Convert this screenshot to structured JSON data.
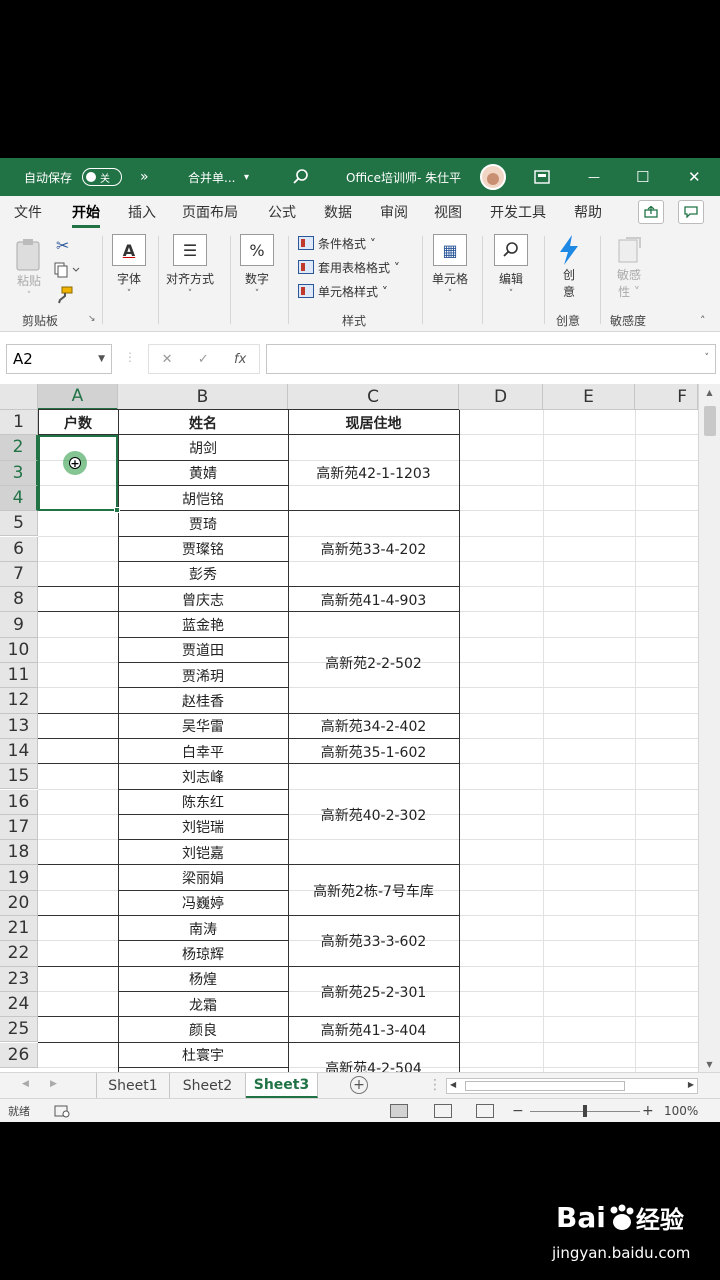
{
  "titlebar": {
    "autosave_label": "自动保存",
    "autosave_state": "关",
    "more": "»",
    "merge_label": "合并单...",
    "merge_arrow": "▾",
    "doc_title": "Office培训师- 朱仕平",
    "minimize": "—",
    "maximize": "☐",
    "close": "✕"
  },
  "tabs": [
    "文件",
    "开始",
    "插入",
    "页面布局",
    "公式",
    "数据",
    "审阅",
    "视图",
    "开发工具",
    "帮助"
  ],
  "ribbon": {
    "paste": "粘贴",
    "clipboard_group": "剪贴板",
    "font": "字体",
    "alignment": "对齐方式",
    "number": "数字",
    "conditional_format": "条件格式 ˅",
    "table_format": "套用表格格式 ˅",
    "cell_style": "单元格样式 ˅",
    "styles_group": "样式",
    "cells": "单元格",
    "editing": "编辑",
    "create_a": "创",
    "create_b": "意",
    "create_group": "创意",
    "sens_a": "敏感",
    "sens_b": "性 ˅",
    "sens_group": "敏感度"
  },
  "formula_bar": {
    "name_box": "A2",
    "cancel": "✕",
    "confirm": "✓",
    "fx": "fx",
    "value": ""
  },
  "columns": [
    "A",
    "B",
    "C",
    "D",
    "E",
    "F"
  ],
  "rows": [
    "1",
    "2",
    "3",
    "4",
    "5",
    "6",
    "7",
    "8",
    "9",
    "10",
    "11",
    "12",
    "13",
    "14",
    "15",
    "16",
    "17",
    "18",
    "19",
    "20",
    "21",
    "22",
    "23",
    "24",
    "25",
    "26"
  ],
  "table": {
    "headers": {
      "a": "户数",
      "b": "姓名",
      "c": "现居住地"
    },
    "names": [
      "胡剑",
      "黄婧",
      "胡恺铭",
      "贾琦",
      "贾璨铭",
      "彭秀",
      "曾庆志",
      "蓝金艳",
      "贾道田",
      "贾浠玥",
      "赵桂香",
      "吴华雷",
      "白幸平",
      "刘志峰",
      "陈东红",
      "刘铠瑞",
      "刘铠嘉",
      "梁丽娟",
      "冯巍婷",
      "南涛",
      "杨琼辉",
      "杨煌",
      "龙霜",
      "颜良",
      "杜寰宇"
    ],
    "addresses": [
      "高新苑42-1-1203",
      "高新苑33-4-202",
      "高新苑41-4-903",
      "高新苑2-2-502",
      "高新苑34-2-402",
      "高新苑35-1-602",
      "高新苑40-2-302",
      "高新苑2栋-7号车库",
      "高新苑33-3-602",
      "高新苑25-2-301",
      "高新苑41-3-404",
      "高新苑4-2-504"
    ]
  },
  "sheets": [
    "Sheet1",
    "Sheet2",
    "Sheet3"
  ],
  "active_sheet": "Sheet3",
  "status": {
    "ready": "就绪",
    "zoom_minus": "−",
    "zoom_plus": "+",
    "zoom": "100%",
    "zoom_level": 1.0
  },
  "watermark": {
    "brand": "Bai",
    "brand_cn": "经验",
    "url": "jingyan.baidu.com"
  }
}
